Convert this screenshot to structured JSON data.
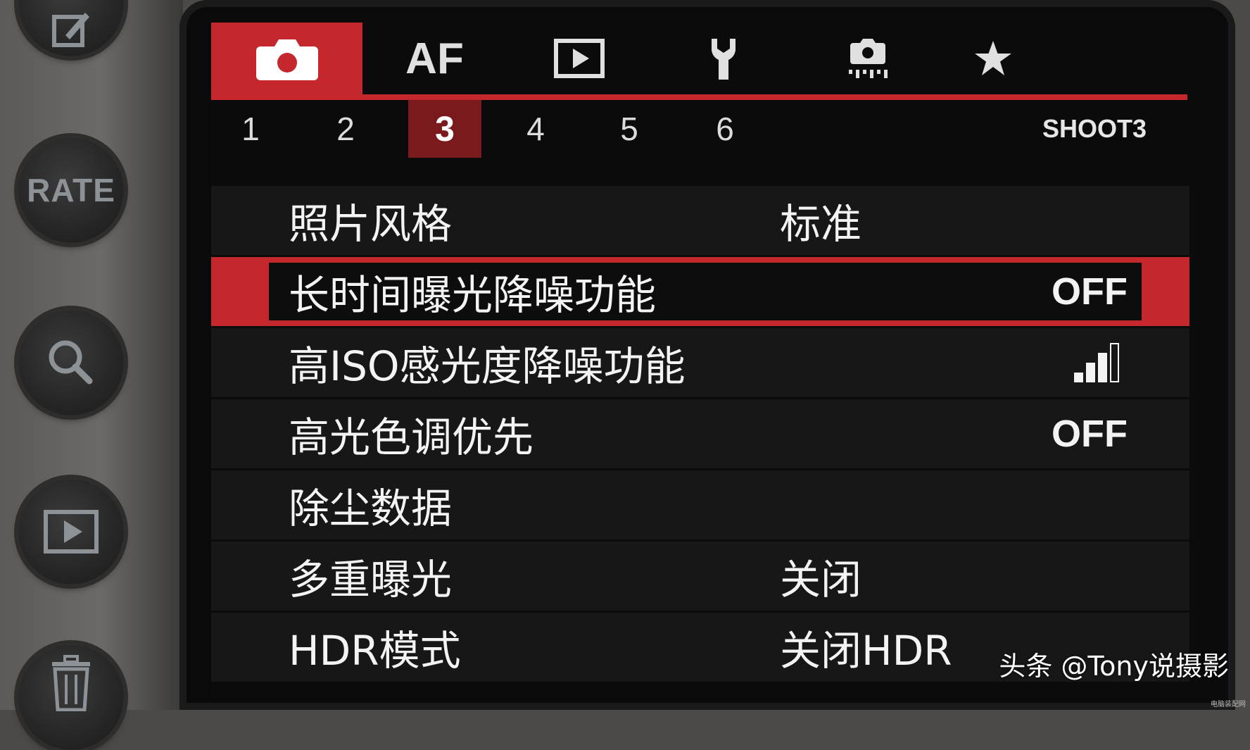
{
  "camera_buttons": {
    "rate_label": "RATE"
  },
  "menu": {
    "tabs": [
      {
        "icon": "camera-icon",
        "active": true
      },
      {
        "label": "AF"
      },
      {
        "icon": "playback-icon"
      },
      {
        "icon": "wrench-icon"
      },
      {
        "icon": "custom-function-icon"
      },
      {
        "icon": "star-icon"
      }
    ],
    "subtabs": [
      "1",
      "2",
      "3",
      "4",
      "5",
      "6"
    ],
    "active_subtab": "3",
    "page_id": "SHOOT3",
    "items": [
      {
        "label": "照片风格",
        "value": "标准"
      },
      {
        "label": "长时间曝光降噪功能",
        "value": "OFF"
      },
      {
        "label": "高ISO感光度降噪功能",
        "value_icon": "nr-level-icon",
        "level": 3,
        "level_max": 4
      },
      {
        "label": "高光色调优先",
        "value": "OFF"
      },
      {
        "label": "除尘数据",
        "value": ""
      },
      {
        "label": "多重曝光",
        "value": "关闭"
      },
      {
        "label": "HDR模式",
        "value": "关闭HDR"
      }
    ],
    "selected_index": 1
  },
  "colors": {
    "accent_red": "#c4282d",
    "active_subtab": "#7a1a1c",
    "text": "#f3f3f3"
  },
  "watermark": "头条 @Tony说摄影",
  "corner_logo": "电脑装配网"
}
